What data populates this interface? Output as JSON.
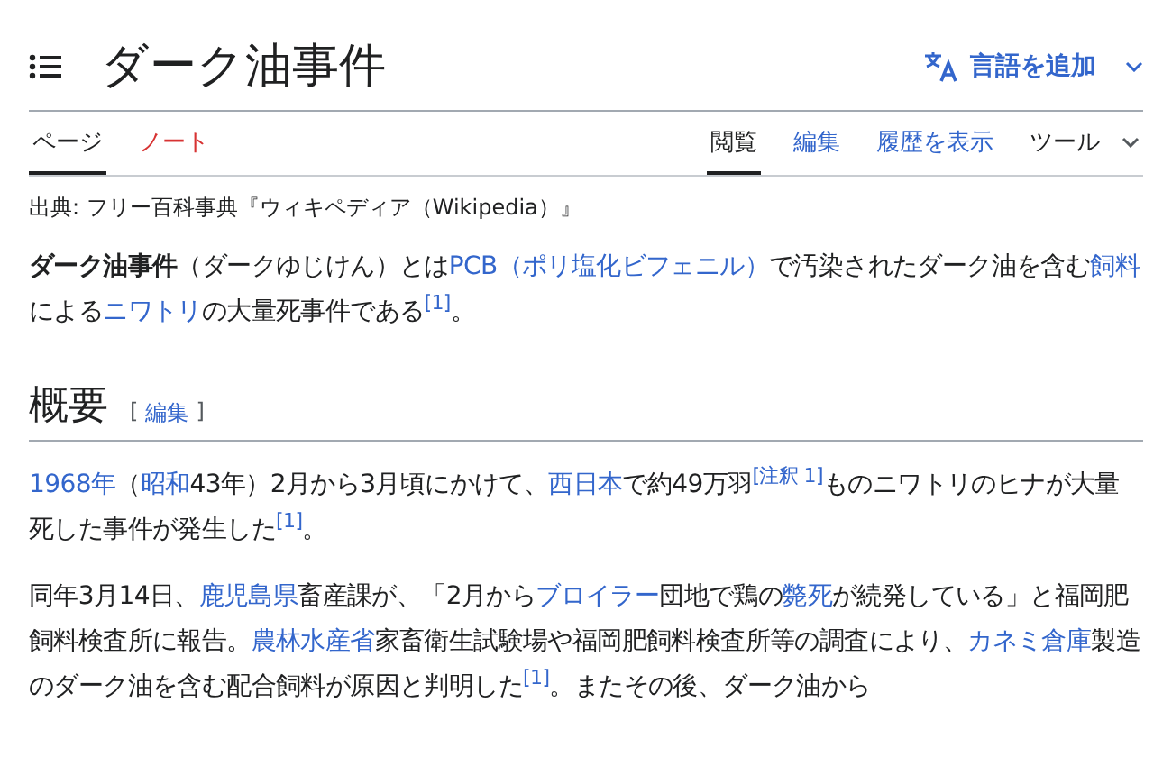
{
  "title": "ダーク油事件",
  "language_button": {
    "label": "言語を追加"
  },
  "left_tabs": [
    {
      "label": "ページ",
      "selected": true,
      "exists": true
    },
    {
      "label": "ノート",
      "selected": false,
      "exists": false
    }
  ],
  "right_tabs": [
    {
      "label": "閲覧",
      "selected": true,
      "kind": "tab"
    },
    {
      "label": "編集",
      "selected": false,
      "kind": "tab"
    },
    {
      "label": "履歴を表示",
      "selected": false,
      "kind": "tab"
    },
    {
      "label": "ツール",
      "selected": false,
      "kind": "menu"
    }
  ],
  "source_note": "出典: フリー百科事典『ウィキペディア（Wikipedia）』",
  "intro": [
    {
      "kind": "bold",
      "text": "ダーク油事件"
    },
    {
      "kind": "text",
      "text": "（ダークゆじけん）とは"
    },
    {
      "kind": "link",
      "text": "PCB（ポリ塩化ビフェニル）"
    },
    {
      "kind": "text",
      "text": "で汚染されたダーク油を含む"
    },
    {
      "kind": "link",
      "text": "飼料"
    },
    {
      "kind": "text",
      "text": "による"
    },
    {
      "kind": "link",
      "text": "ニワトリ"
    },
    {
      "kind": "text",
      "text": "の大量死事件である"
    },
    {
      "kind": "ref",
      "text": "[1]"
    },
    {
      "kind": "text",
      "text": "。"
    }
  ],
  "section": {
    "heading": "概要",
    "edit_link": "編集",
    "edit_brackets": [
      "[",
      "]"
    ],
    "paragraphs": [
      [
        {
          "kind": "link",
          "text": "1968年"
        },
        {
          "kind": "text",
          "text": "（"
        },
        {
          "kind": "link",
          "text": "昭和"
        },
        {
          "kind": "text",
          "text": "43年）2月から3月頃にかけて、"
        },
        {
          "kind": "link",
          "text": "西日本"
        },
        {
          "kind": "text",
          "text": "で約49万羽"
        },
        {
          "kind": "ref",
          "text": "[注釈 1]"
        },
        {
          "kind": "text",
          "text": "ものニワトリのヒナが大量死した事件が発生した"
        },
        {
          "kind": "ref",
          "text": "[1]"
        },
        {
          "kind": "text",
          "text": "。"
        }
      ],
      [
        {
          "kind": "text",
          "text": "同年3月14日、"
        },
        {
          "kind": "link",
          "text": "鹿児島県"
        },
        {
          "kind": "text",
          "text": "畜産課が、「2月から"
        },
        {
          "kind": "link",
          "text": "ブロイラー"
        },
        {
          "kind": "text",
          "text": "団地で鶏の"
        },
        {
          "kind": "link",
          "text": "斃死"
        },
        {
          "kind": "text",
          "text": "が続発している」と福岡肥飼料検査所に報告。"
        },
        {
          "kind": "link",
          "text": "農林水産省"
        },
        {
          "kind": "text",
          "text": "家畜衛生試験場や福岡肥飼料検査所等の調査により、"
        },
        {
          "kind": "link",
          "text": "カネミ倉庫"
        },
        {
          "kind": "text",
          "text": "製造のダーク油を含む配合飼料が原因と判明した"
        },
        {
          "kind": "ref",
          "text": "[1]"
        },
        {
          "kind": "text",
          "text": "。またその後、ダーク油から"
        }
      ]
    ]
  }
}
